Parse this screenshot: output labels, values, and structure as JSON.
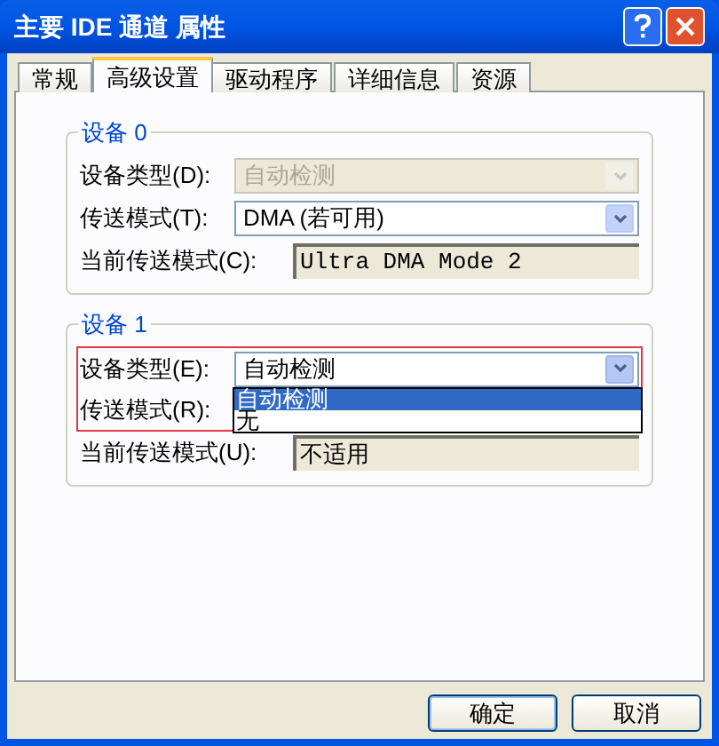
{
  "window": {
    "title": "主要 IDE 通道 属性"
  },
  "tabs": [
    {
      "label": "常规",
      "selected": false
    },
    {
      "label": "高级设置",
      "selected": true
    },
    {
      "label": "驱动程序",
      "selected": false
    },
    {
      "label": "详细信息",
      "selected": false
    },
    {
      "label": "资源",
      "selected": false
    }
  ],
  "groups": [
    {
      "title": "设备 0",
      "rows": [
        {
          "kind": "combo",
          "label": "设备类型(D):",
          "value": "自动检测",
          "disabled": true,
          "highlighted": false
        },
        {
          "kind": "combo",
          "label": "传送模式(T):",
          "value": "DMA (若可用)",
          "disabled": false,
          "highlighted": false
        },
        {
          "kind": "readonly",
          "label": "当前传送模式(C):",
          "value": "Ultra DMA Mode 2",
          "highlighted": false
        }
      ]
    },
    {
      "title": "设备 1",
      "rows": [
        {
          "kind": "combo",
          "label": "设备类型(E):",
          "value": "自动检测",
          "disabled": false,
          "highlighted": true,
          "expanded": true,
          "options": [
            {
              "label": "自动检测",
              "selected": true
            },
            {
              "label": "无",
              "selected": false
            }
          ]
        },
        {
          "kind": "label",
          "label": "传送模式(R):",
          "highlighted": true
        },
        {
          "kind": "readonly",
          "label": "当前传送模式(U):",
          "value": "不适用",
          "highlighted": false
        }
      ]
    }
  ],
  "buttons": [
    {
      "label": "确定",
      "default": true
    },
    {
      "label": "取消",
      "default": false
    }
  ]
}
